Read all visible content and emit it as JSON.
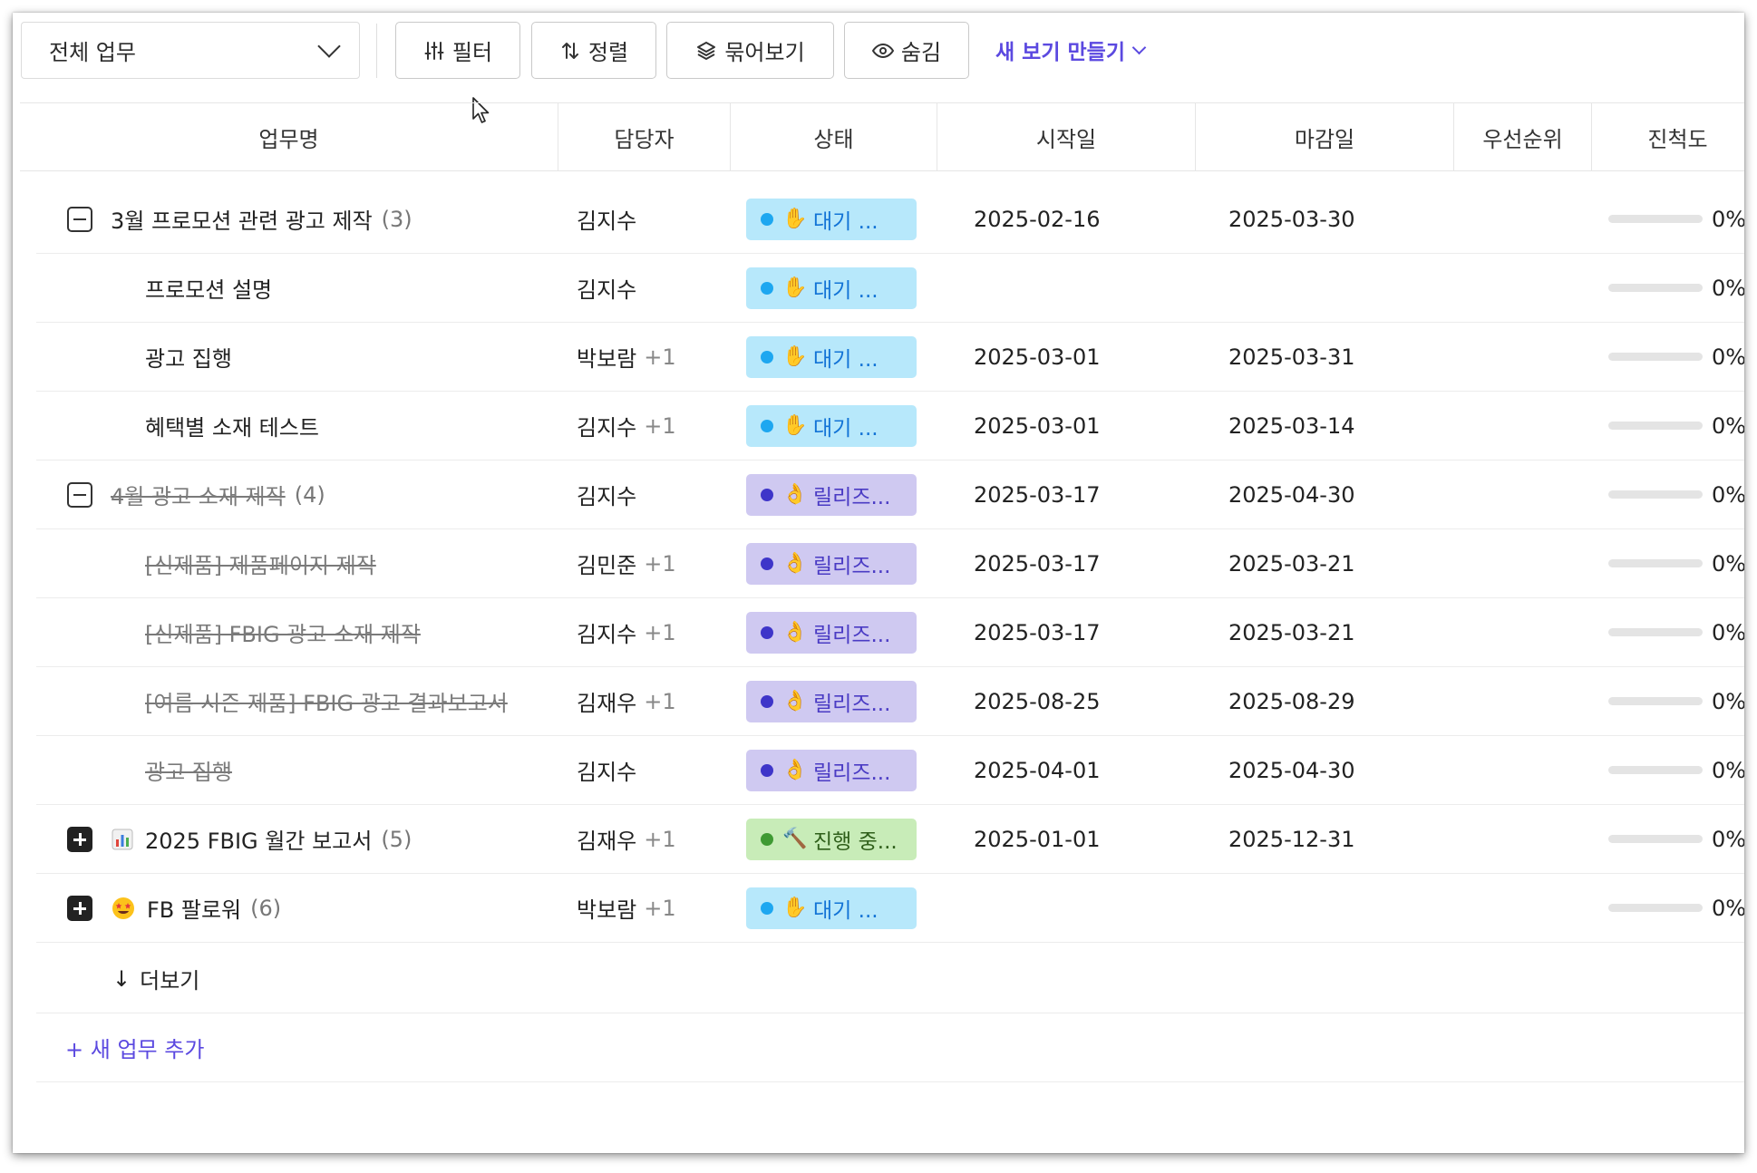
{
  "toolbar": {
    "view_select": "전체 업무",
    "filter": "필터",
    "sort": "정렬",
    "group": "묶어보기",
    "hide": "숨김",
    "new_view": "새 보기 만들기"
  },
  "columns": [
    "업무명",
    "담당자",
    "상태",
    "시작일",
    "마감일",
    "우선순위",
    "진척도"
  ],
  "status_styles": {
    "waiting": {
      "bg": "#b7e8fb",
      "fg": "#1273d6",
      "dot": "#1ea7f0",
      "icon": "✋"
    },
    "release": {
      "bg": "#cfc9f1",
      "fg": "#4a3bc4",
      "dot": "#3e35c9",
      "icon": "👌"
    },
    "progress": {
      "bg": "#c8ecb8",
      "fg": "#2f5f1a",
      "dot": "#3f9a33",
      "icon": "🔨"
    }
  },
  "rows": [
    {
      "type": "group",
      "toggle": "minus",
      "name": "3월 프로모션 관련 광고 제작",
      "count": "(3)",
      "struck": false,
      "assignee": "김지수",
      "extra": "",
      "status": "waiting",
      "status_label": "대기 ...",
      "start": "2025-02-16",
      "due": "2025-03-30",
      "priority": "",
      "progress": 0,
      "progress_label": "0%"
    },
    {
      "type": "child",
      "name": "프로모션 설명",
      "struck": false,
      "assignee": "김지수",
      "extra": "",
      "status": "waiting",
      "status_label": "대기 ...",
      "start": "",
      "due": "",
      "priority": "",
      "progress": 0,
      "progress_label": "0%"
    },
    {
      "type": "child",
      "name": "광고 집행",
      "struck": false,
      "assignee": "박보람",
      "extra": "+1",
      "status": "waiting",
      "status_label": "대기 ...",
      "start": "2025-03-01",
      "due": "2025-03-31",
      "priority": "",
      "progress": 0,
      "progress_label": "0%"
    },
    {
      "type": "child",
      "name": "혜택별 소재 테스트",
      "struck": false,
      "assignee": "김지수",
      "extra": "+1",
      "status": "waiting",
      "status_label": "대기 ...",
      "start": "2025-03-01",
      "due": "2025-03-14",
      "priority": "",
      "progress": 0,
      "progress_label": "0%"
    },
    {
      "type": "group",
      "toggle": "minus",
      "name": "4월 광고 소재 제작",
      "count": "(4)",
      "struck": true,
      "assignee": "김지수",
      "extra": "",
      "status": "release",
      "status_label": "릴리즈...",
      "start": "2025-03-17",
      "due": "2025-04-30",
      "priority": "",
      "progress": 0,
      "progress_label": "0%"
    },
    {
      "type": "child",
      "name": "[신제품] 제품페이지 제작",
      "struck": true,
      "assignee": "김민준",
      "extra": "+1",
      "status": "release",
      "status_label": "릴리즈...",
      "start": "2025-03-17",
      "due": "2025-03-21",
      "priority": "",
      "progress": 0,
      "progress_label": "0%"
    },
    {
      "type": "child",
      "name": "[신제품] FBIG 광고 소재 제작",
      "struck": true,
      "assignee": "김지수",
      "extra": "+1",
      "status": "release",
      "status_label": "릴리즈...",
      "start": "2025-03-17",
      "due": "2025-03-21",
      "priority": "",
      "progress": 0,
      "progress_label": "0%"
    },
    {
      "type": "child",
      "name": "[여름 시즌 제품] FBIG 광고 결과보고서",
      "struck": true,
      "assignee": "김재우",
      "extra": "+1",
      "status": "release",
      "status_label": "릴리즈...",
      "start": "2025-08-25",
      "due": "2025-08-29",
      "priority": "",
      "progress": 0,
      "progress_label": "0%"
    },
    {
      "type": "child",
      "name": "광고 집행",
      "struck": true,
      "assignee": "김지수",
      "extra": "",
      "status": "release",
      "status_label": "릴리즈...",
      "start": "2025-04-01",
      "due": "2025-04-30",
      "priority": "",
      "progress": 0,
      "progress_label": "0%"
    },
    {
      "type": "group",
      "toggle": "plus",
      "icon": "chart",
      "name": "2025 FBIG 월간 보고서",
      "count": "(5)",
      "struck": false,
      "assignee": "김재우",
      "extra": "+1",
      "status": "progress",
      "status_label": "진행 중...",
      "start": "2025-01-01",
      "due": "2025-12-31",
      "priority": "",
      "progress": 0,
      "progress_label": "0%"
    },
    {
      "type": "group",
      "toggle": "plus",
      "icon": "star-eyes",
      "name": "FB 팔로워",
      "count": "(6)",
      "struck": false,
      "assignee": "박보람",
      "extra": "+1",
      "status": "waiting",
      "status_label": "대기 ...",
      "start": "",
      "due": "",
      "priority": "",
      "progress": 0,
      "progress_label": "0%"
    }
  ],
  "more_label": "더보기",
  "add_label": "+ 새 업무 추가"
}
